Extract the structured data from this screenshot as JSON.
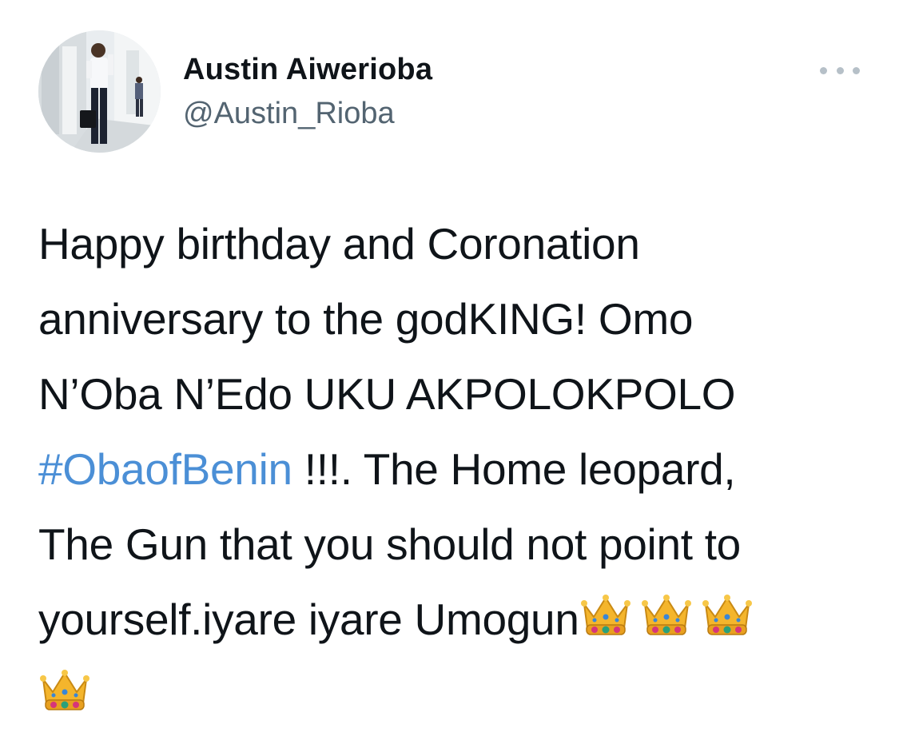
{
  "author": {
    "name": "Austin Aiwerioba",
    "handle": "@Austin_Rioba",
    "avatar_alt": "profile photo"
  },
  "menu": {
    "icon": "more-horizontal-icon"
  },
  "tweet": {
    "lines": [
      "Happy birthday and Coronation",
      "anniversary to the godKING! Omo",
      "N’Oba N’Edo UKU AKPOLOKPOLO"
    ],
    "hashtag": "#ObaofBenin",
    "line4_rest": " !!!. The Home leopard,",
    "line5": "The Gun that you should not point to",
    "line6": "yourself.iyare iyare Umogun",
    "emoji": "crown-emoji",
    "crown_count_line6": 3,
    "crown_count_line7": 1
  },
  "colors": {
    "hashtag": "#4b8fd6",
    "handle": "#536471",
    "text": "#0f1419",
    "menu_dots": "#b6c0c8"
  }
}
